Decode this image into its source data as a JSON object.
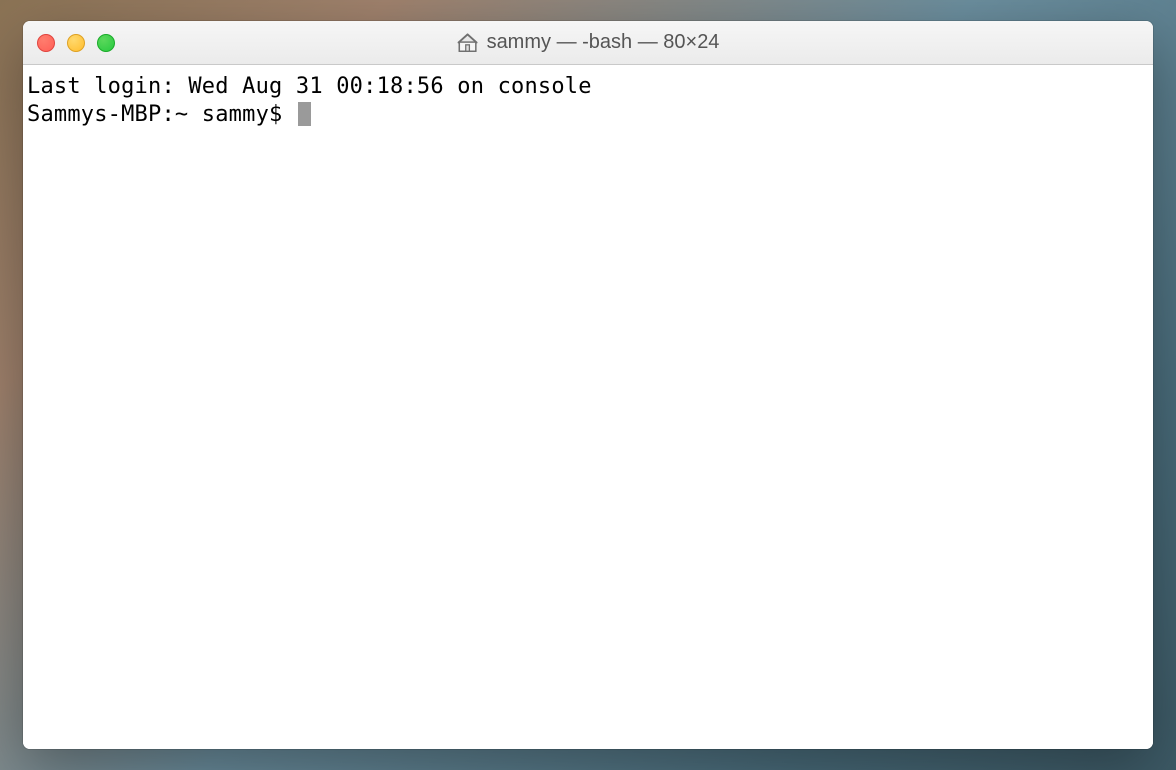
{
  "window": {
    "title": "sammy — -bash — 80×24"
  },
  "terminal": {
    "last_login": "Last login: Wed Aug 31 00:18:56 on console",
    "prompt": "Sammys-MBP:~ sammy$ "
  }
}
